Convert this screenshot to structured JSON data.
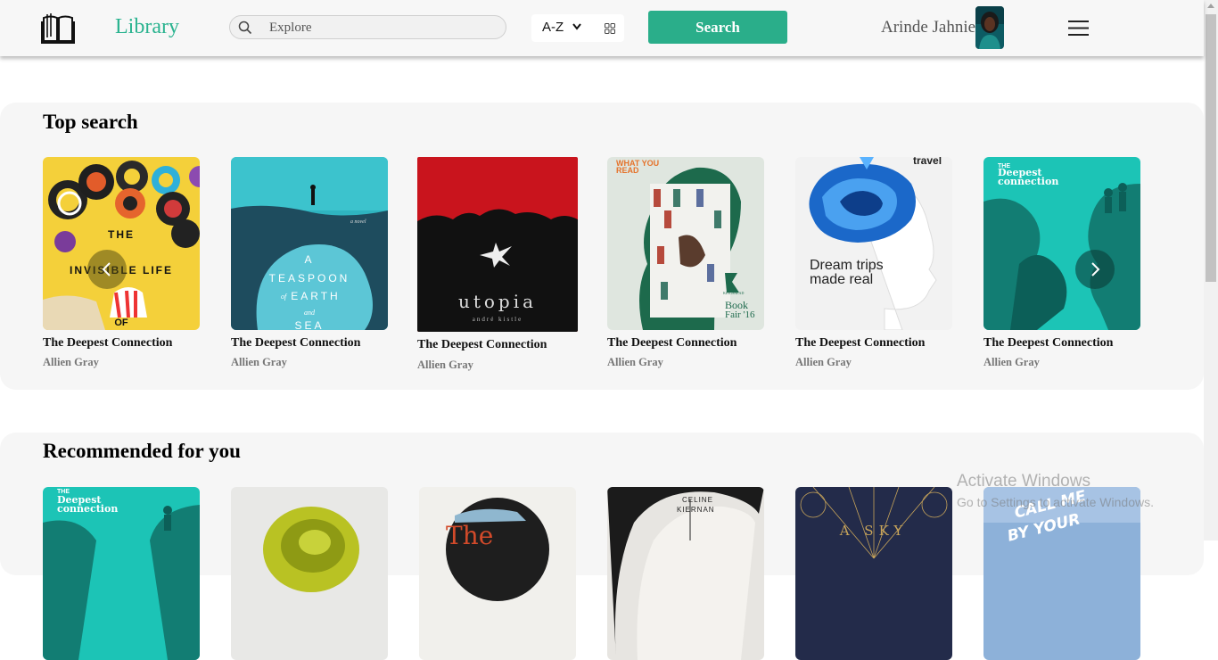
{
  "header": {
    "brand": "Library",
    "search_placeholder": "Explore",
    "sort_value": "A-Z",
    "search_button": "Search",
    "user_name": "Arinde Jahniel"
  },
  "icons": {
    "logo": "open-book-icon",
    "search": "magnifier-icon",
    "sort": "chevron-down-icon",
    "view": "grid-view-icon",
    "menu": "hamburger-menu-icon",
    "prev": "chevron-left-icon",
    "next": "chevron-right-icon"
  },
  "colors": {
    "accent": "#2aae8a",
    "brand": "#2ab38f"
  },
  "sections": [
    {
      "title": "Top search",
      "books": [
        {
          "cover_text": [
            "THE",
            "INVISIBLE LIFE",
            "OF"
          ],
          "title": "The Deepest Connection",
          "author": "Allien Gray"
        },
        {
          "cover_text": [
            "a novel",
            "A",
            "TEASPOON",
            "of",
            "EARTH",
            "and",
            "SEA"
          ],
          "title": "The Deepest Connection",
          "author": "Allien Gray"
        },
        {
          "cover_text": [
            "utopia",
            "andré kistle"
          ],
          "title": "The Deepest Connection",
          "author": "Allien Gray"
        },
        {
          "cover_text": [
            "WHAT YOU",
            "READ",
            "KINGSHEAD",
            "Book",
            "Fair '16"
          ],
          "title": "The Deepest Connection",
          "author": "Allien Gray"
        },
        {
          "cover_text": [
            "travel",
            "Dream trips",
            "made real"
          ],
          "title": "The Deepest Connection",
          "author": "Allien Gray"
        },
        {
          "cover_text": [
            "THE",
            "Deepest",
            "connection"
          ],
          "title": "The Deepest Connection",
          "author": "Allien Gray"
        }
      ]
    },
    {
      "title": "Recommended for you",
      "books": [
        {
          "cover_text": [
            "THE",
            "Deepest",
            "connection"
          ]
        },
        {
          "cover_text": []
        },
        {
          "cover_text": [
            "The"
          ]
        },
        {
          "cover_text": [
            "CELINE",
            "KIERNAN"
          ]
        },
        {
          "cover_text": [
            "A SKY"
          ]
        },
        {
          "cover_text": [
            "CALL ME",
            "BY YOUR"
          ]
        }
      ]
    }
  ],
  "os": {
    "watermark_title": "Activate Windows",
    "watermark_sub": "Go to Settings to activate Windows."
  }
}
